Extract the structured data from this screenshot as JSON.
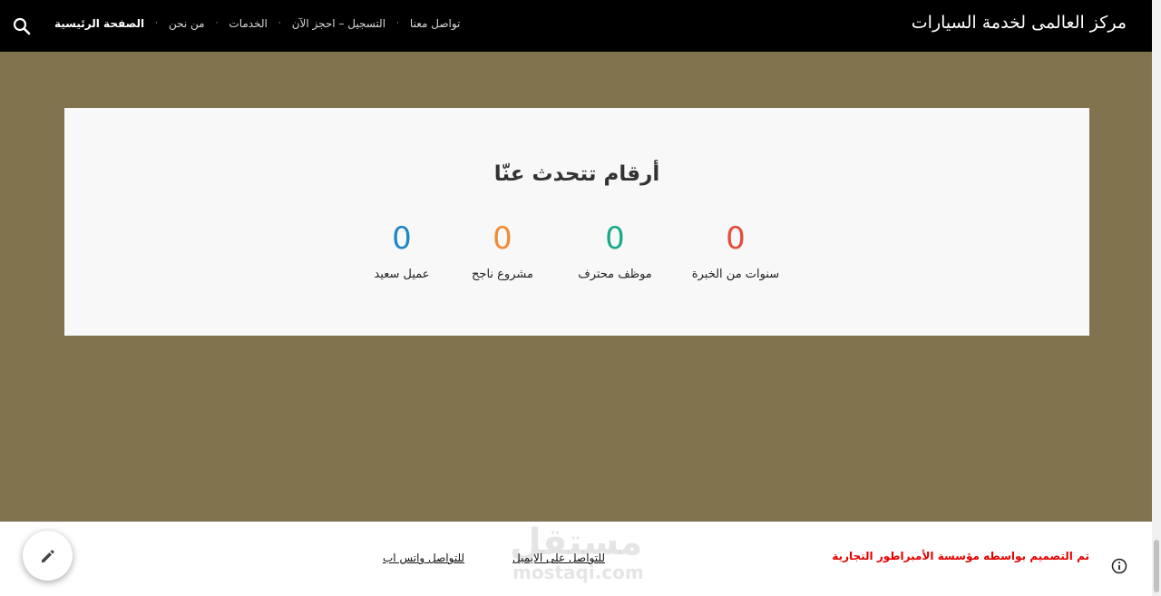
{
  "header": {
    "site_title": "مركز العالمى لخدمة السيارات",
    "nav": [
      {
        "label": "الصفحة الرئيسية",
        "active": true
      },
      {
        "label": "من نحن"
      },
      {
        "label": "الخدمات"
      },
      {
        "label": "التسجيل – احجز الآن"
      },
      {
        "label": "تواصل معنا"
      }
    ],
    "nav_separator": "·",
    "search_icon": "search-icon"
  },
  "stats": {
    "heading": "أرقام تتحدث عنّا",
    "items": [
      {
        "value": "0",
        "label": "سنوات من الخبرة",
        "color": "#e74c3c"
      },
      {
        "value": "0",
        "label": "موظف محترف",
        "color": "#1aaa8c"
      },
      {
        "value": "0",
        "label": "مشروع ناجح",
        "color": "#f08c38"
      },
      {
        "value": "0",
        "label": "عميل سعيد",
        "color": "#1f87c6"
      }
    ]
  },
  "footer": {
    "credit": "تم التصميم بواسطه مؤسسة الأمبراطور التجارية",
    "email_link": "للتواصل على الايميل",
    "whatsapp_link": "للتواصل واتس اب",
    "watermark_ar": "مستقل",
    "watermark_en": "mostaqi.com",
    "info_icon": "info-icon",
    "fab_icon": "pencil-icon"
  },
  "colors": {
    "page_background": "#82734f",
    "header_background": "#000000",
    "credit_text": "#e60000"
  }
}
